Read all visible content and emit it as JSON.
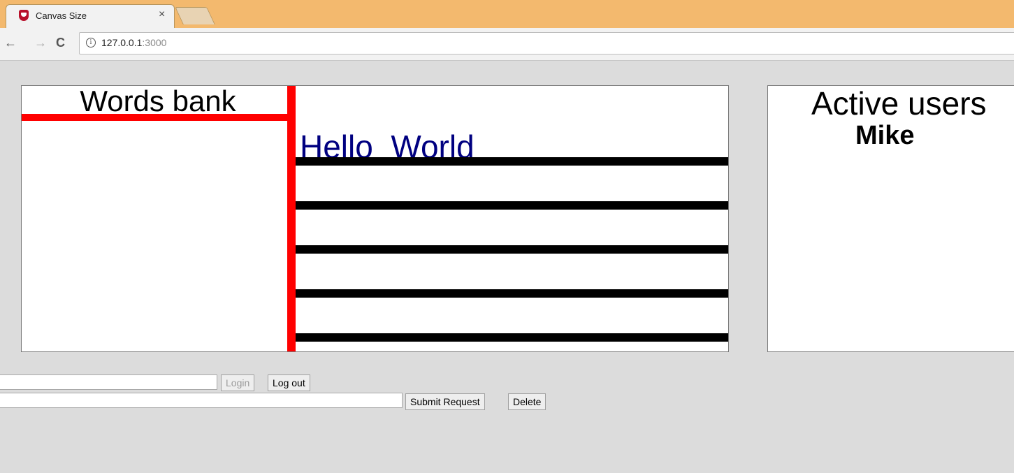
{
  "browser": {
    "tab_title": "Canvas Size",
    "tab_close": "×",
    "nav": {
      "back": "←",
      "forward": "→",
      "reload": "C"
    },
    "url_host": "127.0.0.1",
    "url_port": ":3000",
    "info_glyph": "i"
  },
  "words_panel": {
    "title": "Words bank",
    "text": "Hello  World"
  },
  "users_panel": {
    "title": "Active users",
    "users": [
      "Mike"
    ]
  },
  "login_form": {
    "username_value": "",
    "login_label": "Login",
    "logout_label": "Log out"
  },
  "request_form": {
    "request_value": "",
    "submit_label": "Submit Request",
    "delete_label": "Delete"
  },
  "colors": {
    "divider": "#ff0000",
    "lines": "#000000",
    "hello_text": "#000080",
    "page_bg": "#dcdcdc",
    "tabstrip": "#f3b96e"
  }
}
